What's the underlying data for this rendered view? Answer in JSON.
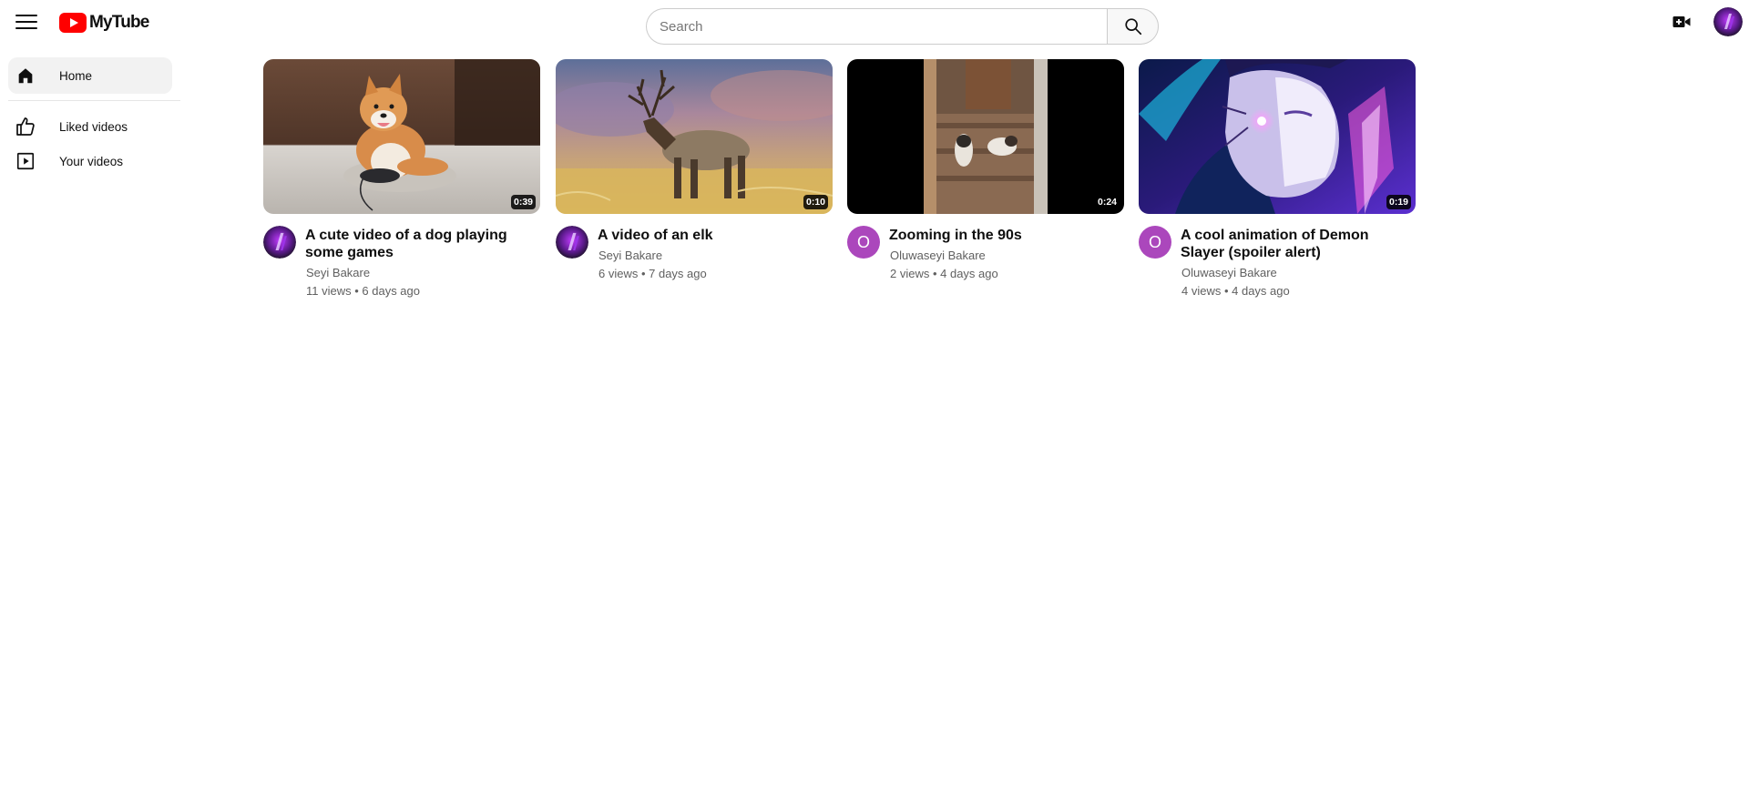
{
  "header": {
    "logo_text": "MyTube",
    "search_placeholder": "Search"
  },
  "sidebar": {
    "items": [
      {
        "label": "Home",
        "icon": "home-icon",
        "active": true
      },
      {
        "label": "Liked videos",
        "icon": "thumbs-up-icon",
        "active": false
      },
      {
        "label": "Your videos",
        "icon": "play-square-icon",
        "active": false
      }
    ]
  },
  "videos": [
    {
      "title": "A cute video of a dog playing some games",
      "channel": "Seyi Bakare",
      "stats": "11 views • 6 days ago",
      "duration": "0:39",
      "avatar": "image",
      "thumbnail": "dog"
    },
    {
      "title": "A video of an elk",
      "channel": "Seyi Bakare",
      "stats": "6 views • 7 days ago",
      "duration": "0:10",
      "avatar": "image",
      "thumbnail": "elk"
    },
    {
      "title": "Zooming in the 90s",
      "channel": "Oluwaseyi Bakare",
      "stats": "2 views • 4 days ago",
      "duration": "0:24",
      "avatar": "O",
      "thumbnail": "cats"
    },
    {
      "title": "A cool animation of Demon Slayer (spoiler alert)",
      "channel": "Oluwaseyi Bakare",
      "stats": "4 views • 4 days ago",
      "duration": "0:19",
      "avatar": "O",
      "thumbnail": "anime"
    }
  ],
  "colors": {
    "brand": "#ff0000",
    "letter_avatar": "#ab47bc",
    "active_nav": "#f2f2f2"
  }
}
